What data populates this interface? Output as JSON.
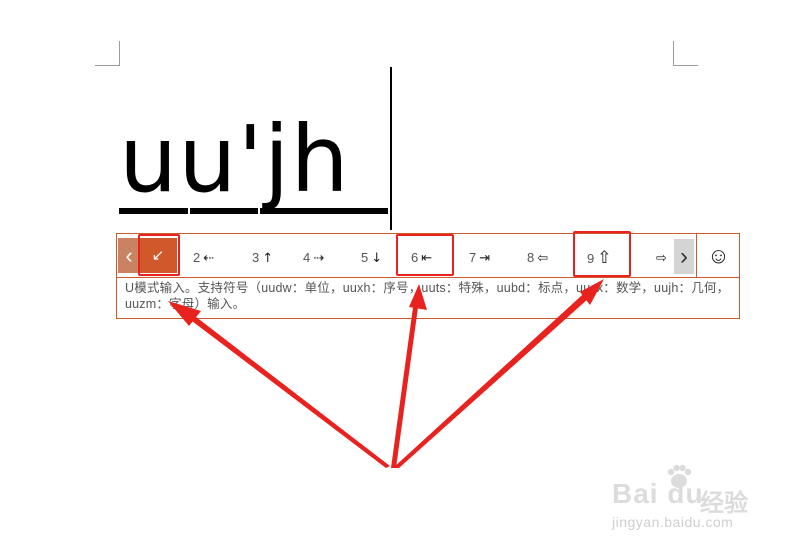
{
  "document": {
    "typed_text": "uu'jh"
  },
  "ime": {
    "prev_label": "‹",
    "candidates": [
      {
        "num": "1",
        "sym": "↙"
      },
      {
        "num": "2",
        "sym": "⇠"
      },
      {
        "num": "3",
        "sym": "↑"
      },
      {
        "num": "4",
        "sym": "⇢"
      },
      {
        "num": "5",
        "sym": "↓"
      },
      {
        "num": "6",
        "sym": "⇤"
      },
      {
        "num": "7",
        "sym": "⇥"
      },
      {
        "num": "8",
        "sym": "⇦"
      },
      {
        "num": "9",
        "sym": "⇧"
      },
      {
        "num": "",
        "sym": "⇨"
      }
    ],
    "next_label": "›",
    "emoji_label": "☺",
    "hint": "U模式输入。支持符号（uudw：单位，uuxh：序号，uuts：特殊，uubd：标点，uusx：数学，uujh：几何，uuzm：字母）输入。"
  },
  "annotation": {
    "color": "#e8221e"
  },
  "watermark": {
    "logo": "Bai  du",
    "cn": "经验",
    "url": "jingyan.baidu.com"
  }
}
